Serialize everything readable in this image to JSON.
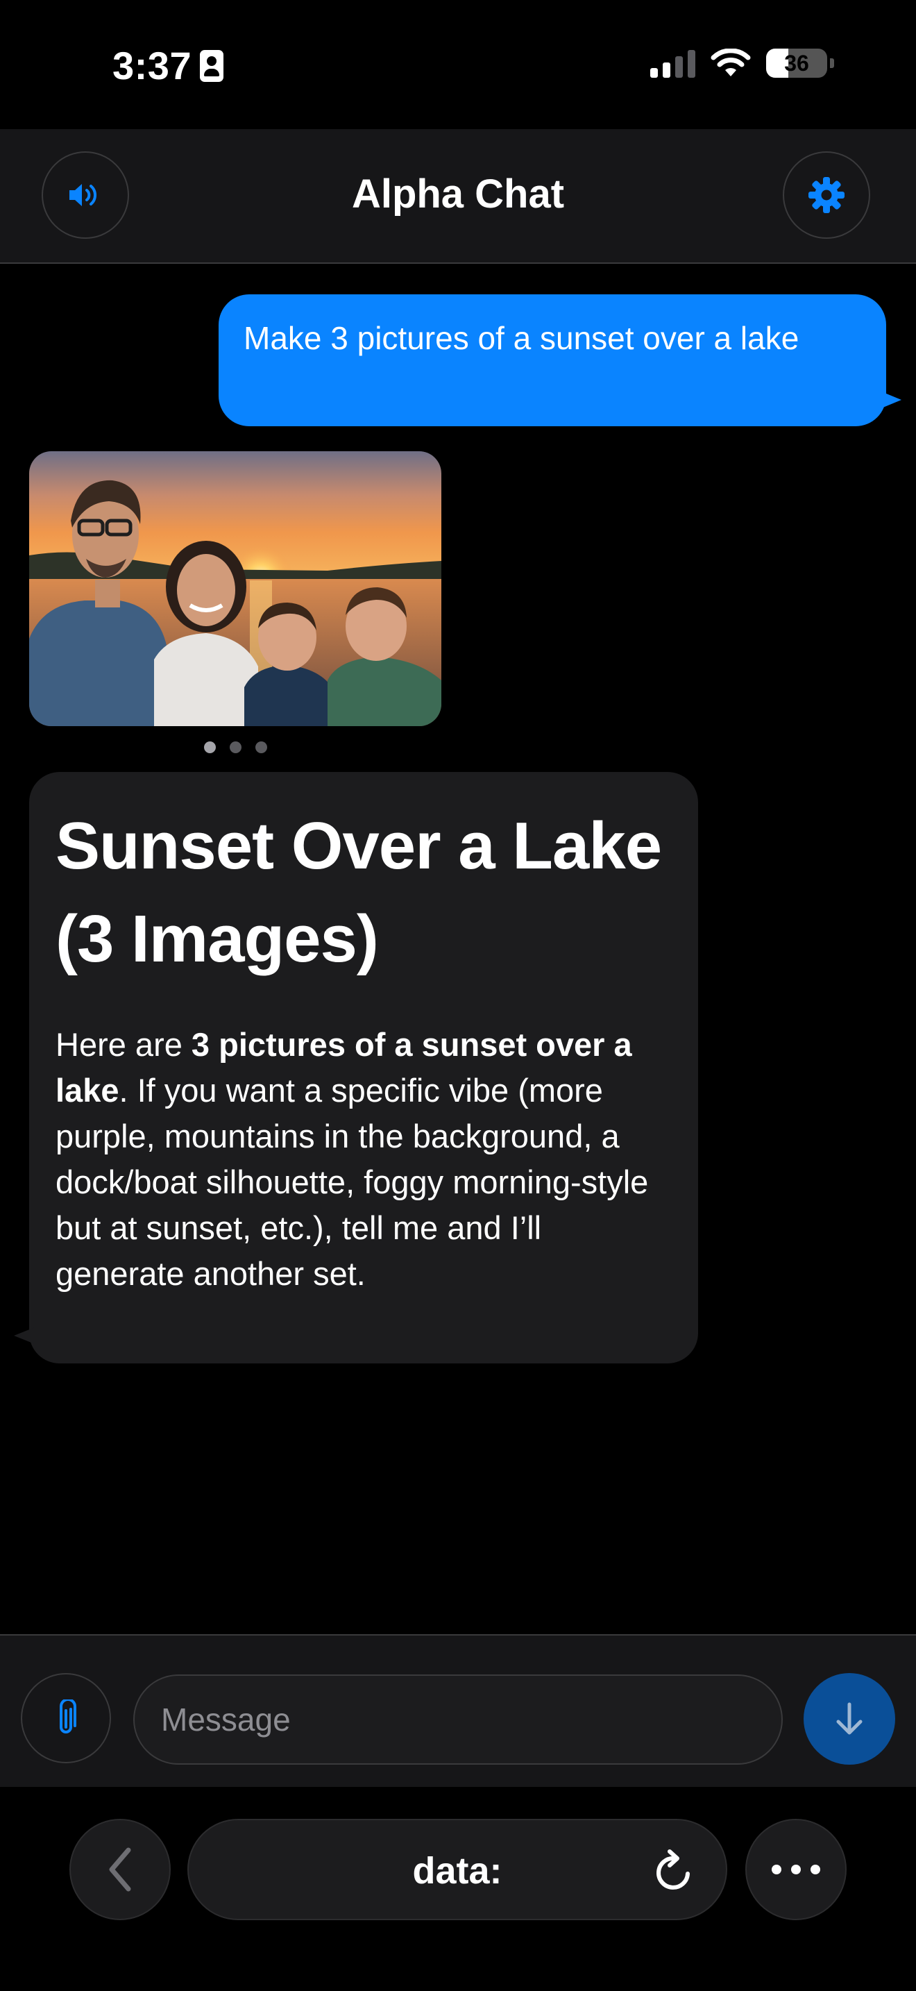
{
  "status_bar": {
    "time": "3:37",
    "battery_level": "36",
    "battery_fraction": 0.36
  },
  "header": {
    "title": "Alpha Chat",
    "left_icon": "speaker-icon",
    "right_icon": "gear-icon"
  },
  "colors": {
    "accent": "#0a84ff",
    "send_button": "#0a4f98",
    "bubble_dark": "#1c1c1e",
    "background": "#000000"
  },
  "chat": {
    "user_message": "Make 3 pictures of a sunset over a lake",
    "image_carousel": {
      "count": 3,
      "active_index": 0
    },
    "reply": {
      "heading": "Sunset Over a Lake (3 Images)",
      "intro": "Here are ",
      "bold": "3 pictures of a sunset over a lake",
      "rest": ". If you want a specific vibe (more purple, mountains in the background, a dock/boat silhouette, foggy morning-style but at sunset, etc.), tell me and I’ll generate another set."
    }
  },
  "composer": {
    "placeholder": "Message",
    "attach_icon": "paperclip-icon",
    "send_icon": "arrow-down-icon"
  },
  "browser": {
    "address": "data:",
    "back_icon": "chevron-left-icon",
    "reload_icon": "reload-icon",
    "more_icon": "more-icon"
  }
}
